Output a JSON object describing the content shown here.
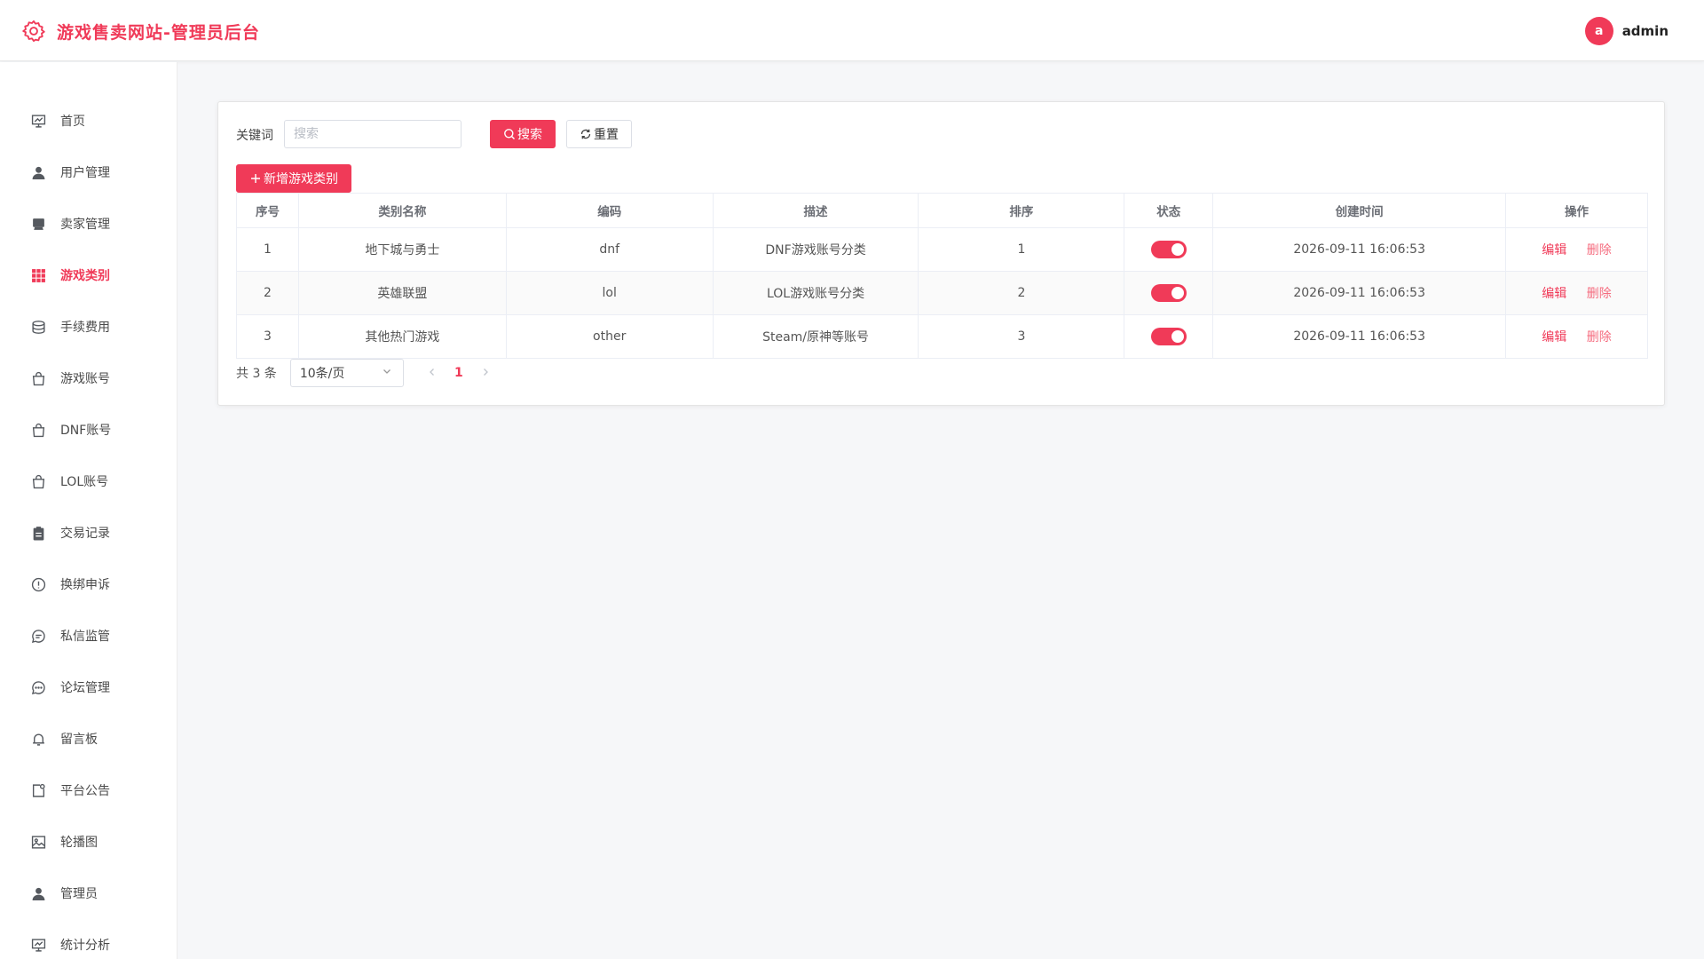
{
  "header": {
    "title": "游戏售卖网站-管理员后台",
    "avatar_letter": "a",
    "username": "admin"
  },
  "colors": {
    "accent": "#f03a58",
    "background": "#f6f7f9"
  },
  "sidebar": {
    "items": [
      {
        "label": "首页",
        "icon": "presentation-board-icon",
        "active": false
      },
      {
        "label": "用户管理",
        "icon": "user-icon",
        "active": false
      },
      {
        "label": "卖家管理",
        "icon": "seller-icon",
        "active": false
      },
      {
        "label": "游戏类别",
        "icon": "grid-icon",
        "active": true
      },
      {
        "label": "手续费用",
        "icon": "coins-icon",
        "active": false
      },
      {
        "label": "游戏账号",
        "icon": "bag-icon",
        "active": false
      },
      {
        "label": "DNF账号",
        "icon": "bag-icon",
        "active": false
      },
      {
        "label": "LOL账号",
        "icon": "bag-icon",
        "active": false
      },
      {
        "label": "交易记录",
        "icon": "clipboard-icon",
        "active": false
      },
      {
        "label": "换绑申诉",
        "icon": "alert-circle-icon",
        "active": false
      },
      {
        "label": "私信监管",
        "icon": "chat-bubble-icon",
        "active": false
      },
      {
        "label": "论坛管理",
        "icon": "chat-dots-icon",
        "active": false
      },
      {
        "label": "留言板",
        "icon": "bell-icon",
        "active": false
      },
      {
        "label": "平台公告",
        "icon": "notice-icon",
        "active": false
      },
      {
        "label": "轮播图",
        "icon": "picture-icon",
        "active": false
      },
      {
        "label": "管理员",
        "icon": "admin-user-icon",
        "active": false
      },
      {
        "label": "统计分析",
        "icon": "presentation-chart-icon",
        "active": false
      }
    ]
  },
  "filter": {
    "keyword_label": "关键词",
    "keyword_value": "",
    "keyword_placeholder": "搜索",
    "search_label": "搜索",
    "reset_label": "重置",
    "add_label": "新增游戏类别"
  },
  "table": {
    "columns": [
      "序号",
      "类别名称",
      "编码",
      "描述",
      "排序",
      "状态",
      "创建时间",
      "操作"
    ],
    "rows": [
      {
        "index": "1",
        "name": "地下城与勇士",
        "code": "dnf",
        "desc": "DNF游戏账号分类",
        "sort": "1",
        "status_on": true,
        "created": "2026-09-11 16:06:53"
      },
      {
        "index": "2",
        "name": "英雄联盟",
        "code": "lol",
        "desc": "LOL游戏账号分类",
        "sort": "2",
        "status_on": true,
        "created": "2026-09-11 16:06:53"
      },
      {
        "index": "3",
        "name": "其他热门游戏",
        "code": "other",
        "desc": "Steam/原神等账号",
        "sort": "3",
        "status_on": true,
        "created": "2026-09-11 16:06:53"
      }
    ],
    "edit_label": "编辑",
    "delete_label": "删除"
  },
  "pagination": {
    "total_text": "共 3 条",
    "page_size": "10条/页",
    "current_page": "1"
  }
}
